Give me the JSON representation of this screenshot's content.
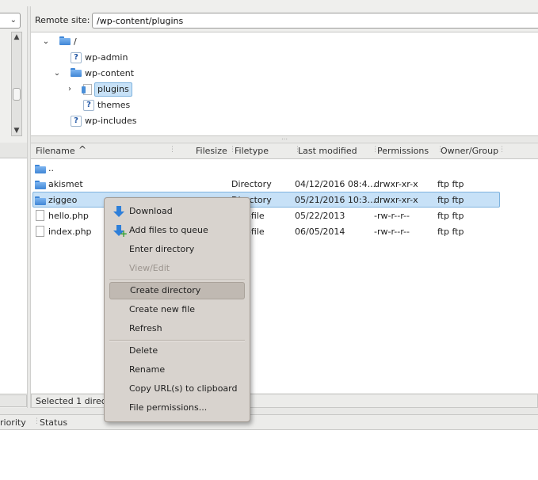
{
  "remote": {
    "label": "Remote site:",
    "path": "/wp-content/plugins"
  },
  "tree": [
    {
      "label": "/",
      "expander": "⌄",
      "icon": "server-folder"
    },
    {
      "label": "wp-admin",
      "expander": "",
      "icon": "unknown-folder"
    },
    {
      "label": "wp-content",
      "expander": "⌄",
      "icon": "folder"
    },
    {
      "label": "plugins",
      "expander": "›",
      "icon": "open-folder",
      "selected": true
    },
    {
      "label": "themes",
      "expander": "",
      "icon": "unknown-folder"
    },
    {
      "label": "wp-includes",
      "expander": "",
      "icon": "unknown-folder"
    }
  ],
  "columns": {
    "filename": "Filename",
    "sort_icon": "^",
    "filesize": "Filesize",
    "filetype": "Filetype",
    "last_modified": "Last modified",
    "permissions": "Permissions",
    "owner": "Owner/Group"
  },
  "files": [
    {
      "name": "..",
      "type": "",
      "modified": "",
      "perms": "",
      "owner": "",
      "icon": "folder"
    },
    {
      "name": "akismet",
      "type": "Directory",
      "modified": "04/12/2016 08:4...",
      "perms": "drwxr-xr-x",
      "owner": "ftp ftp",
      "icon": "folder"
    },
    {
      "name": "ziggeo",
      "type": "Directory",
      "modified": "05/21/2016 10:3...",
      "perms": "drwxr-xr-x",
      "owner": "ftp ftp",
      "icon": "folder",
      "selected": true
    },
    {
      "name": "hello.php",
      "type": "php-file",
      "modified": "05/22/2013",
      "perms": "-rw-r--r--",
      "owner": "ftp ftp",
      "icon": "file"
    },
    {
      "name": "index.php",
      "type": "php-file",
      "modified": "06/05/2014",
      "perms": "-rw-r--r--",
      "owner": "ftp ftp",
      "icon": "file"
    }
  ],
  "status": "Selected 1 directory.",
  "queue": {
    "priority": "riority",
    "status": "Status"
  },
  "context_menu": [
    {
      "label": "Download",
      "icon": "download-icon"
    },
    {
      "label": "Add files to queue",
      "icon": "add-to-queue-icon"
    },
    {
      "label": "Enter directory"
    },
    {
      "label": "View/Edit",
      "disabled": true
    },
    {
      "label": "Create directory",
      "highlighted": true
    },
    {
      "label": "Create new file"
    },
    {
      "label": "Refresh"
    },
    {
      "label": "Delete"
    },
    {
      "label": "Rename"
    },
    {
      "label": "Copy URL(s) to clipboard"
    },
    {
      "label": "File permissions..."
    }
  ],
  "colors": {
    "selection": "#c7e1f7",
    "menu_bg": "#d8d3ce",
    "folder": "#3f86d6"
  }
}
